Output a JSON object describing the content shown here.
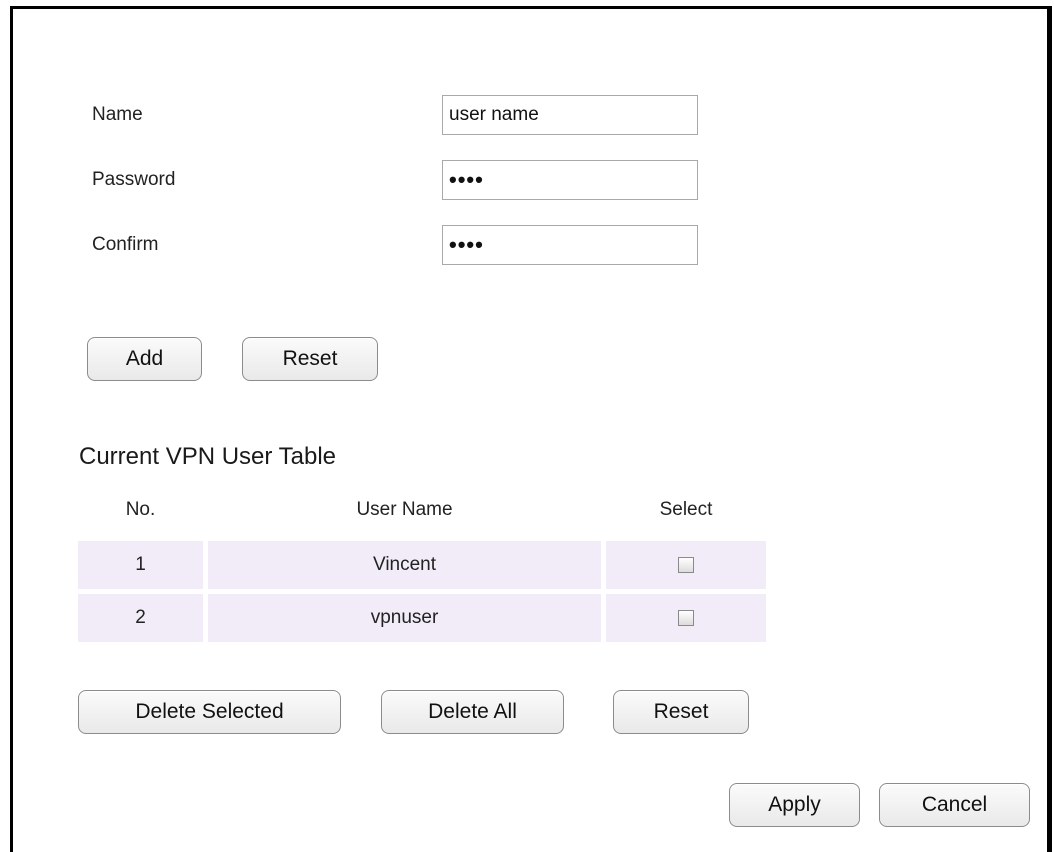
{
  "form": {
    "name_label": "Name",
    "name_value": "user name",
    "password_label": "Password",
    "password_value": "••••",
    "confirm_label": "Confirm",
    "confirm_value": "••••",
    "add_label": "Add",
    "reset_label": "Reset"
  },
  "table": {
    "title": "Current VPN User Table",
    "headers": [
      "No.",
      "User Name",
      "Select"
    ],
    "rows": [
      {
        "no": "1",
        "user": "Vincent",
        "selected": false
      },
      {
        "no": "2",
        "user": "vpnuser",
        "selected": false
      }
    ],
    "delete_selected_label": "Delete Selected",
    "delete_all_label": "Delete All",
    "reset_label": "Reset"
  },
  "footer": {
    "apply_label": "Apply",
    "cancel_label": "Cancel"
  }
}
